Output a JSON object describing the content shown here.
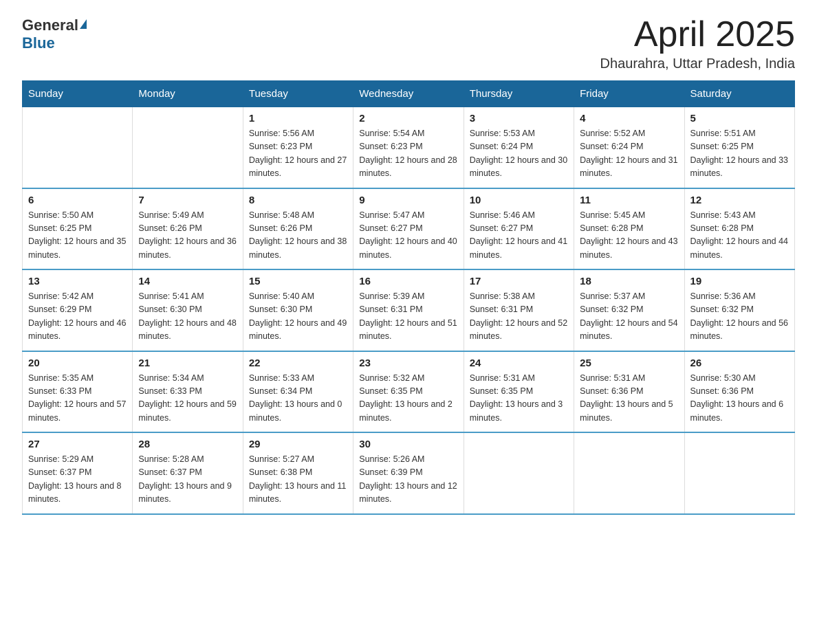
{
  "header": {
    "logo_general": "General",
    "logo_blue": "Blue",
    "month_title": "April 2025",
    "location": "Dhaurahra, Uttar Pradesh, India"
  },
  "days_of_week": [
    "Sunday",
    "Monday",
    "Tuesday",
    "Wednesday",
    "Thursday",
    "Friday",
    "Saturday"
  ],
  "weeks": [
    [
      {
        "day": "",
        "sunrise": "",
        "sunset": "",
        "daylight": ""
      },
      {
        "day": "",
        "sunrise": "",
        "sunset": "",
        "daylight": ""
      },
      {
        "day": "1",
        "sunrise": "Sunrise: 5:56 AM",
        "sunset": "Sunset: 6:23 PM",
        "daylight": "Daylight: 12 hours and 27 minutes."
      },
      {
        "day": "2",
        "sunrise": "Sunrise: 5:54 AM",
        "sunset": "Sunset: 6:23 PM",
        "daylight": "Daylight: 12 hours and 28 minutes."
      },
      {
        "day": "3",
        "sunrise": "Sunrise: 5:53 AM",
        "sunset": "Sunset: 6:24 PM",
        "daylight": "Daylight: 12 hours and 30 minutes."
      },
      {
        "day": "4",
        "sunrise": "Sunrise: 5:52 AM",
        "sunset": "Sunset: 6:24 PM",
        "daylight": "Daylight: 12 hours and 31 minutes."
      },
      {
        "day": "5",
        "sunrise": "Sunrise: 5:51 AM",
        "sunset": "Sunset: 6:25 PM",
        "daylight": "Daylight: 12 hours and 33 minutes."
      }
    ],
    [
      {
        "day": "6",
        "sunrise": "Sunrise: 5:50 AM",
        "sunset": "Sunset: 6:25 PM",
        "daylight": "Daylight: 12 hours and 35 minutes."
      },
      {
        "day": "7",
        "sunrise": "Sunrise: 5:49 AM",
        "sunset": "Sunset: 6:26 PM",
        "daylight": "Daylight: 12 hours and 36 minutes."
      },
      {
        "day": "8",
        "sunrise": "Sunrise: 5:48 AM",
        "sunset": "Sunset: 6:26 PM",
        "daylight": "Daylight: 12 hours and 38 minutes."
      },
      {
        "day": "9",
        "sunrise": "Sunrise: 5:47 AM",
        "sunset": "Sunset: 6:27 PM",
        "daylight": "Daylight: 12 hours and 40 minutes."
      },
      {
        "day": "10",
        "sunrise": "Sunrise: 5:46 AM",
        "sunset": "Sunset: 6:27 PM",
        "daylight": "Daylight: 12 hours and 41 minutes."
      },
      {
        "day": "11",
        "sunrise": "Sunrise: 5:45 AM",
        "sunset": "Sunset: 6:28 PM",
        "daylight": "Daylight: 12 hours and 43 minutes."
      },
      {
        "day": "12",
        "sunrise": "Sunrise: 5:43 AM",
        "sunset": "Sunset: 6:28 PM",
        "daylight": "Daylight: 12 hours and 44 minutes."
      }
    ],
    [
      {
        "day": "13",
        "sunrise": "Sunrise: 5:42 AM",
        "sunset": "Sunset: 6:29 PM",
        "daylight": "Daylight: 12 hours and 46 minutes."
      },
      {
        "day": "14",
        "sunrise": "Sunrise: 5:41 AM",
        "sunset": "Sunset: 6:30 PM",
        "daylight": "Daylight: 12 hours and 48 minutes."
      },
      {
        "day": "15",
        "sunrise": "Sunrise: 5:40 AM",
        "sunset": "Sunset: 6:30 PM",
        "daylight": "Daylight: 12 hours and 49 minutes."
      },
      {
        "day": "16",
        "sunrise": "Sunrise: 5:39 AM",
        "sunset": "Sunset: 6:31 PM",
        "daylight": "Daylight: 12 hours and 51 minutes."
      },
      {
        "day": "17",
        "sunrise": "Sunrise: 5:38 AM",
        "sunset": "Sunset: 6:31 PM",
        "daylight": "Daylight: 12 hours and 52 minutes."
      },
      {
        "day": "18",
        "sunrise": "Sunrise: 5:37 AM",
        "sunset": "Sunset: 6:32 PM",
        "daylight": "Daylight: 12 hours and 54 minutes."
      },
      {
        "day": "19",
        "sunrise": "Sunrise: 5:36 AM",
        "sunset": "Sunset: 6:32 PM",
        "daylight": "Daylight: 12 hours and 56 minutes."
      }
    ],
    [
      {
        "day": "20",
        "sunrise": "Sunrise: 5:35 AM",
        "sunset": "Sunset: 6:33 PM",
        "daylight": "Daylight: 12 hours and 57 minutes."
      },
      {
        "day": "21",
        "sunrise": "Sunrise: 5:34 AM",
        "sunset": "Sunset: 6:33 PM",
        "daylight": "Daylight: 12 hours and 59 minutes."
      },
      {
        "day": "22",
        "sunrise": "Sunrise: 5:33 AM",
        "sunset": "Sunset: 6:34 PM",
        "daylight": "Daylight: 13 hours and 0 minutes."
      },
      {
        "day": "23",
        "sunrise": "Sunrise: 5:32 AM",
        "sunset": "Sunset: 6:35 PM",
        "daylight": "Daylight: 13 hours and 2 minutes."
      },
      {
        "day": "24",
        "sunrise": "Sunrise: 5:31 AM",
        "sunset": "Sunset: 6:35 PM",
        "daylight": "Daylight: 13 hours and 3 minutes."
      },
      {
        "day": "25",
        "sunrise": "Sunrise: 5:31 AM",
        "sunset": "Sunset: 6:36 PM",
        "daylight": "Daylight: 13 hours and 5 minutes."
      },
      {
        "day": "26",
        "sunrise": "Sunrise: 5:30 AM",
        "sunset": "Sunset: 6:36 PM",
        "daylight": "Daylight: 13 hours and 6 minutes."
      }
    ],
    [
      {
        "day": "27",
        "sunrise": "Sunrise: 5:29 AM",
        "sunset": "Sunset: 6:37 PM",
        "daylight": "Daylight: 13 hours and 8 minutes."
      },
      {
        "day": "28",
        "sunrise": "Sunrise: 5:28 AM",
        "sunset": "Sunset: 6:37 PM",
        "daylight": "Daylight: 13 hours and 9 minutes."
      },
      {
        "day": "29",
        "sunrise": "Sunrise: 5:27 AM",
        "sunset": "Sunset: 6:38 PM",
        "daylight": "Daylight: 13 hours and 11 minutes."
      },
      {
        "day": "30",
        "sunrise": "Sunrise: 5:26 AM",
        "sunset": "Sunset: 6:39 PM",
        "daylight": "Daylight: 13 hours and 12 minutes."
      },
      {
        "day": "",
        "sunrise": "",
        "sunset": "",
        "daylight": ""
      },
      {
        "day": "",
        "sunrise": "",
        "sunset": "",
        "daylight": ""
      },
      {
        "day": "",
        "sunrise": "",
        "sunset": "",
        "daylight": ""
      }
    ]
  ]
}
